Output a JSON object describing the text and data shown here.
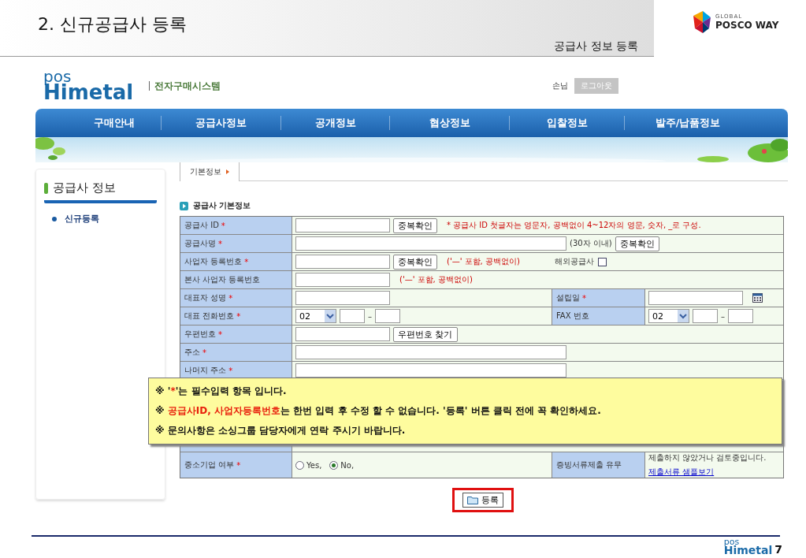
{
  "slide": {
    "title": "2. 신규공급사 등록",
    "subtitle": "공급사 정보 등록",
    "brand_small": "GLOBAL",
    "brand": "POSCO WAY"
  },
  "site": {
    "logo_top": "pos",
    "logo_bottom": "Himetal",
    "system_name": "전자구매시스템",
    "user": "손님",
    "logout": "로그아웃"
  },
  "nav": [
    {
      "label": "구매안내"
    },
    {
      "label": "공급사정보"
    },
    {
      "label": "공개정보"
    },
    {
      "label": "협상정보"
    },
    {
      "label": "입찰정보"
    },
    {
      "label": "발주/납품정보"
    }
  ],
  "tabs": [
    {
      "label": "기본정보",
      "selected": true
    }
  ],
  "sidebar": {
    "title": "공급사 정보",
    "items": [
      {
        "label": "신규등록",
        "selected": true
      }
    ]
  },
  "section": {
    "title": "공급사 기본정보"
  },
  "form_rows": [
    {
      "kind": "wide",
      "label": "공급사 ID",
      "mark": "*",
      "content": [
        {
          "kind": "input"
        },
        {
          "kind": "button",
          "label": "중복확인"
        },
        {
          "kind": "note",
          "text": "* 공급사 ID 첫글자는 영문자, 공백없이 4~12자의 영문, 숫자, _로 구성."
        }
      ]
    },
    {
      "kind": "wide",
      "label": "공급사명",
      "mark": "*",
      "content": [
        {
          "kind": "wide_input"
        },
        {
          "kind": "text",
          "text": "(30자 이내)"
        },
        {
          "kind": "button",
          "label": "중복확인"
        }
      ]
    },
    {
      "kind": "wide",
      "label": "사업자 등록번호",
      "mark": "*",
      "content": [
        {
          "kind": "input"
        },
        {
          "kind": "button",
          "label": "중복확인"
        },
        {
          "kind": "note",
          "text": "('—' 포함, 공백없이)"
        },
        {
          "kind": "checkbox",
          "label": "해외공급사",
          "checked": false
        }
      ]
    },
    {
      "kind": "wide",
      "label": "본사 사업자 등록번호",
      "content": [
        {
          "kind": "input"
        },
        {
          "kind": "note",
          "text": "('—' 포함, 공백없이)"
        }
      ]
    },
    {
      "kind": "split",
      "label": "대표자 성명",
      "mark": "*",
      "content": [
        {
          "kind": "input"
        }
      ],
      "label2": "설립일",
      "mark2": "*",
      "content2": [
        {
          "kind": "input"
        },
        {
          "kind": "calendar"
        }
      ]
    },
    {
      "kind": "split",
      "label": "대표 전화번호",
      "mark": "*",
      "content": [
        {
          "kind": "select",
          "value": "02"
        },
        {
          "kind": "short_input"
        },
        {
          "kind": "dash",
          "text": "–"
        },
        {
          "kind": "short_input"
        }
      ],
      "label2": "FAX 번호",
      "content2": [
        {
          "kind": "select",
          "value": "02"
        },
        {
          "kind": "short_input"
        },
        {
          "kind": "dash",
          "text": "–"
        },
        {
          "kind": "short_input"
        }
      ]
    },
    {
      "kind": "wide",
      "label": "우편번호",
      "mark": "*",
      "content": [
        {
          "kind": "input"
        },
        {
          "kind": "button",
          "label": "우편번호 찾기"
        }
      ]
    },
    {
      "kind": "wide",
      "label": "주소",
      "mark": "*",
      "content": [
        {
          "kind": "wide_input"
        }
      ]
    },
    {
      "kind": "wide",
      "label": "나머지 주소",
      "mark": "*",
      "content": [
        {
          "kind": "wide_input"
        }
      ]
    },
    {
      "kind": "blank"
    },
    {
      "kind": "blank"
    },
    {
      "kind": "blank"
    },
    {
      "kind": "blank"
    },
    {
      "kind": "split",
      "label": "중소기업 여부",
      "mark": "*",
      "content": [
        {
          "kind": "radio",
          "label": "Yes,",
          "selected": false
        },
        {
          "kind": "radio",
          "label": "No,",
          "selected": true
        }
      ],
      "label2": "증빙서류제출 유무",
      "content2": [
        {
          "kind": "text",
          "text": "제출하지 않았거나 검토중입니다."
        },
        {
          "kind": "link",
          "text": "제출서류 샘플보기"
        }
      ]
    }
  ],
  "notice": {
    "lines": [
      {
        "parts": [
          {
            "text": "※ '"
          },
          {
            "text": "*",
            "highlight": true
          },
          {
            "text": "'는 필수입력 항목 입니다."
          }
        ]
      },
      {
        "parts": [
          {
            "text": "※ "
          },
          {
            "text": "공급사ID, 사업자등록번호",
            "highlight": true
          },
          {
            "text": "는 한번 입력 후 수정 할 수 없습니다. '등록' 버튼 클릭 전에 꼭 확인하세요."
          }
        ]
      },
      {
        "parts": [
          {
            "text": "※ 문의사항은 소싱그룹 담당자에게 연락 주시기 바랍니다."
          }
        ]
      }
    ]
  },
  "submit": {
    "label": "등록",
    "outlined": true
  },
  "footer": {
    "logo_top": "pos",
    "logo_bottom": "Himetal",
    "page": "7"
  }
}
